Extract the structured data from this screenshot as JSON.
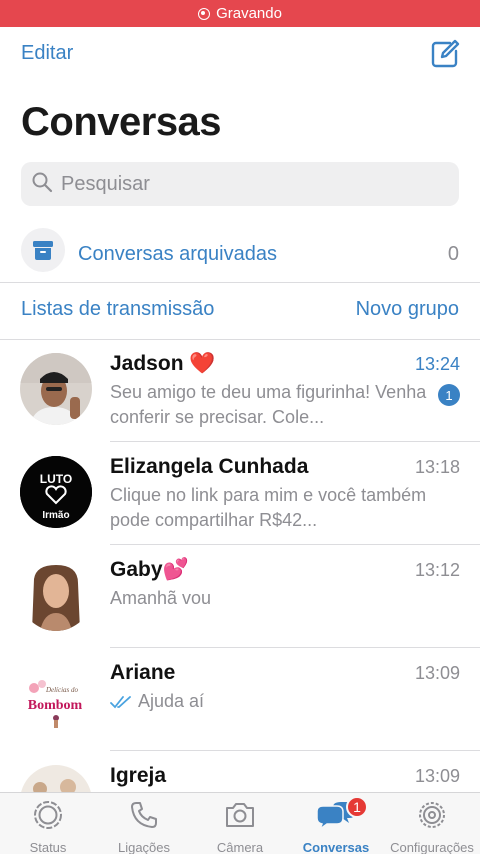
{
  "recording": {
    "label": "Gravando",
    "color": "#e5474e"
  },
  "header": {
    "edit_label": "Editar",
    "title": "Conversas"
  },
  "search": {
    "placeholder": "Pesquisar"
  },
  "archived": {
    "label": "Conversas arquivadas",
    "count": "0"
  },
  "actions": {
    "broadcast_label": "Listas de transmissão",
    "new_group_label": "Novo grupo"
  },
  "chats": [
    {
      "name": "Jadson ❤️",
      "time": "13:24",
      "preview": "Seu amigo te deu uma figurinha! Venha conferir se precisar.  Cole...",
      "unread": "1"
    },
    {
      "name": "Elizangela Cunhada",
      "time": "13:18",
      "preview": "Clique no link para mim e você também pode compartilhar R$42..."
    },
    {
      "name": "Gaby💕",
      "time": "13:12",
      "preview": "Amanhã vou"
    },
    {
      "name": "Ariane",
      "time": "13:09",
      "preview": "Ajuda aí"
    },
    {
      "name": "Igreja",
      "time": "13:09",
      "preview": ""
    }
  ],
  "avatar_text": {
    "luto": "LUTO",
    "irmao": "Irmão",
    "bombom_small": "Delícias do",
    "bombom": "Bombom"
  },
  "tabs": [
    {
      "label": "Status",
      "icon": "status-icon"
    },
    {
      "label": "Ligações",
      "icon": "phone-icon"
    },
    {
      "label": "Câmera",
      "icon": "camera-icon"
    },
    {
      "label": "Conversas",
      "icon": "chats-icon",
      "badge": "1",
      "active": true
    },
    {
      "label": "Configurações",
      "icon": "gear-icon"
    }
  ],
  "colors": {
    "accent": "#3a82c4",
    "badge_red": "#e53935"
  }
}
